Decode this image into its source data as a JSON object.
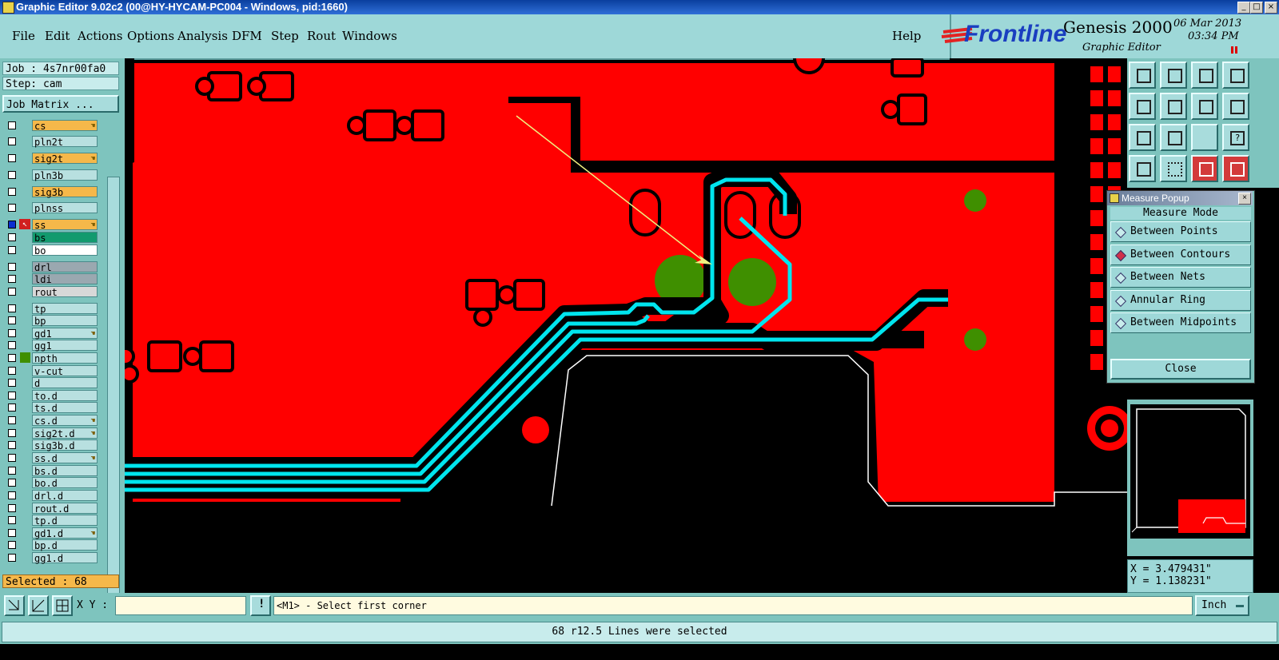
{
  "window": {
    "title": "Graphic Editor 9.02c2 (00@HY-HYCAM-PC004 - Windows, pid:1660)",
    "minimize": "_",
    "maximize": "□",
    "close": "×"
  },
  "menu": {
    "items": [
      "File",
      "Edit",
      "Actions",
      "Options",
      "Analysis",
      "DFM",
      "Step",
      "Rout",
      "Windows"
    ],
    "help": "Help"
  },
  "brand": {
    "logo": "Frontline",
    "product": "Genesis 2000",
    "subtitle": "Graphic Editor",
    "date": "06 Mar 2013",
    "time": "03:34 PM"
  },
  "job": {
    "job_label": "Job : 4s7nr00fa0",
    "step_label": "Step: cam",
    "matrix_button": "Job Matrix ..."
  },
  "layers": [
    {
      "name": "cs",
      "color": "#f5b84a",
      "hand": true
    },
    {
      "name": "pln2t",
      "color": "#b8e0e0",
      "hand": false
    },
    {
      "name": "sig2t",
      "color": "#f5b84a",
      "hand": true
    },
    {
      "name": "pln3b",
      "color": "#b8e0e0",
      "hand": false
    },
    {
      "name": "sig3b",
      "color": "#f5b84a",
      "hand": false
    },
    {
      "name": "plnss",
      "color": "#b8e0e0",
      "hand": false
    },
    {
      "name": "ss",
      "color": "#f5b84a",
      "hand": true,
      "active": true
    },
    {
      "name": "bs",
      "color": "#129a6e",
      "hand": false
    },
    {
      "name": "bo",
      "color": "#ffffff",
      "hand": false
    },
    {
      "name": "drl",
      "color": "#9aa8b0",
      "hand": false
    },
    {
      "name": "ldi",
      "color": "#9aa8b0",
      "hand": false
    },
    {
      "name": "rout",
      "color": "#d8d8d8",
      "hand": false
    },
    {
      "name": "tp",
      "color": "#b8e0e0",
      "hand": false
    },
    {
      "name": "bp",
      "color": "#b8e0e0",
      "hand": false
    },
    {
      "name": "gd1",
      "color": "#b8e0e0",
      "hand": true
    },
    {
      "name": "gg1",
      "color": "#b8e0e0",
      "hand": false
    },
    {
      "name": "npth",
      "color": "#b8e0e0",
      "hand": false,
      "green": true
    },
    {
      "name": "v-cut",
      "color": "#b8e0e0",
      "hand": false
    },
    {
      "name": "d",
      "color": "#b8e0e0",
      "hand": false
    },
    {
      "name": "to.d",
      "color": "#b8e0e0",
      "hand": false
    },
    {
      "name": "ts.d",
      "color": "#b8e0e0",
      "hand": false
    },
    {
      "name": "cs.d",
      "color": "#b8e0e0",
      "hand": true
    },
    {
      "name": "sig2t.d",
      "color": "#b8e0e0",
      "hand": true
    },
    {
      "name": "sig3b.d",
      "color": "#b8e0e0",
      "hand": false
    },
    {
      "name": "ss.d",
      "color": "#b8e0e0",
      "hand": true
    },
    {
      "name": "bs.d",
      "color": "#b8e0e0",
      "hand": false
    },
    {
      "name": "bo.d",
      "color": "#b8e0e0",
      "hand": false
    },
    {
      "name": "drl.d",
      "color": "#b8e0e0",
      "hand": false
    },
    {
      "name": "rout.d",
      "color": "#b8e0e0",
      "hand": false
    },
    {
      "name": "tp.d",
      "color": "#b8e0e0",
      "hand": false
    },
    {
      "name": "gd1.d",
      "color": "#b8e0e0",
      "hand": true
    },
    {
      "name": "bp.d",
      "color": "#b8e0e0",
      "hand": false
    },
    {
      "name": "gg1.d",
      "color": "#b8e0e0",
      "hand": false
    }
  ],
  "selected": "Selected : 68",
  "measure_popup": {
    "title": "Measure Popup",
    "mode_label": "Measure Mode",
    "options": [
      "Between Points",
      "Between Contours",
      "Between Nets",
      "Annular Ring",
      "Between Midpoints"
    ],
    "selected_option": "Between Contours",
    "close_button": "Close"
  },
  "toolbar_icons": [
    "zoom-home-icon",
    "zoom-down-icon",
    "home-icon",
    "fit-window-icon",
    "pan-left-icon",
    "pan-right-icon",
    "toggle-view-icon",
    "snap-icon",
    "zoom-fit-icon",
    "zoom-center-icon",
    "scale-1-2-icon",
    "help-icon",
    "layer-tools-icon",
    "grid-icon",
    "net-highlight-icon",
    "net-compare-icon"
  ],
  "coords": {
    "x": "X = 3.479431\"",
    "y": "Y = 1.138231\""
  },
  "bottom": {
    "xy_label": "X Y :",
    "xy_value": "",
    "prompt": "<M1> - Select first corner",
    "units": "Inch"
  },
  "status": "68 r12.5 Lines were selected",
  "colors": {
    "copper": "#ff0000",
    "trace_selected": "#00e5ee",
    "pad_green": "#3f8f00",
    "background": "#000000",
    "measure_arrow": "#f0f080"
  }
}
